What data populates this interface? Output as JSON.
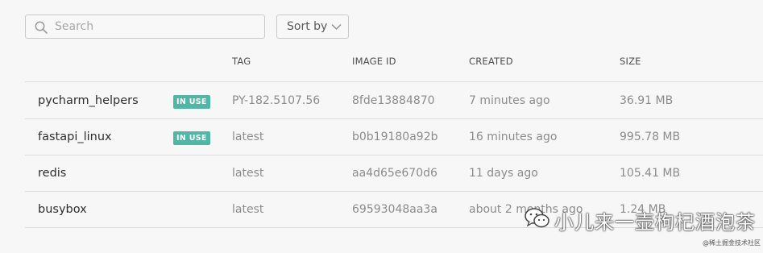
{
  "search": {
    "placeholder": "Search",
    "icon": "search-icon"
  },
  "sort": {
    "label": "Sort by",
    "icon": "chevron-down-icon"
  },
  "table": {
    "columns": [
      "TAG",
      "IMAGE ID",
      "CREATED",
      "SIZE"
    ],
    "rows": [
      {
        "name": "pycharm_helpers",
        "badge": "IN USE",
        "tag": "PY-182.5107.56",
        "image_id": "8fde13884870",
        "created": "7 minutes ago",
        "size": "36.91 MB"
      },
      {
        "name": "fastapi_linux",
        "badge": "IN USE",
        "tag": "latest",
        "image_id": "b0b19180a92b",
        "created": "16 minutes ago",
        "size": "995.78 MB"
      },
      {
        "name": "redis",
        "badge": "",
        "tag": "latest",
        "image_id": "aa4d65e670d6",
        "created": "11 days ago",
        "size": "105.41 MB"
      },
      {
        "name": "busybox",
        "badge": "",
        "tag": "latest",
        "image_id": "69593048aa3a",
        "created": "about 2 months ago",
        "size": "1.24 MB"
      }
    ]
  },
  "colors": {
    "badge_bg": "#4fb7a3",
    "background": "#f7f7f7",
    "divider": "#dcdcdc"
  },
  "watermark": {
    "text": "小儿来一壶枸杞酒泡茶",
    "sub": "@稀土掘金技术社区",
    "icon": "wechat-icon"
  }
}
